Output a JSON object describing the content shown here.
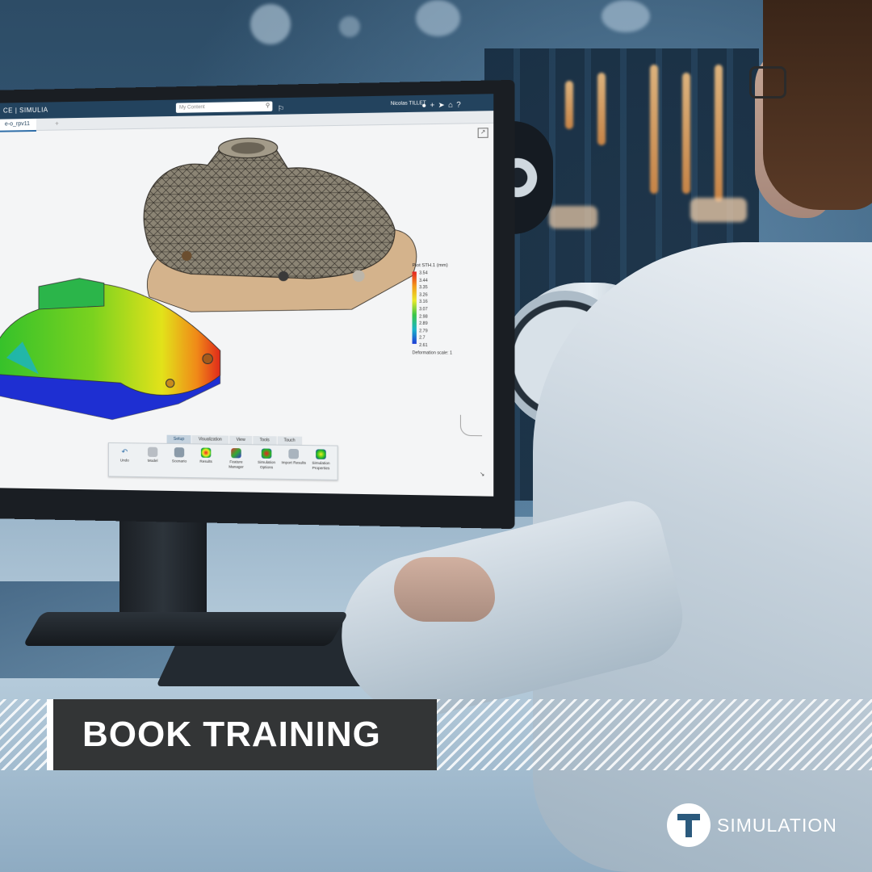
{
  "app": {
    "brand": "CE | SIMULIA",
    "search_placeholder": "My Content",
    "user_name": "Nicolas TILLET",
    "tab_label": "e-o_rpv11",
    "tab_add": "+"
  },
  "legend": {
    "title": "Plot STH.1 (mm)",
    "values": [
      "3.54",
      "3.44",
      "3.35",
      "3.26",
      "3.16",
      "3.07",
      "2.98",
      "2.89",
      "2.79",
      "2.7",
      "2.61"
    ],
    "deformation_scale": "Deformation scale: 1"
  },
  "ribbon": {
    "tabs": [
      "Setup",
      "Visualization",
      "View",
      "Tools",
      "Touch"
    ],
    "active_tab": "Setup",
    "tools": [
      {
        "label": "Undo",
        "icon": "undo-icon"
      },
      {
        "label": "Model",
        "icon": "model-icon"
      },
      {
        "label": "Scenario",
        "icon": "scenario-icon"
      },
      {
        "label": "Results",
        "icon": "results-icon"
      },
      {
        "label": "Feature Manager",
        "icon": "feature-manager-icon"
      },
      {
        "label": "Simulation Options",
        "icon": "simulation-options-icon"
      },
      {
        "label": "Import Results",
        "icon": "import-results-icon"
      },
      {
        "label": "Simulation Properties",
        "icon": "simulation-properties-icon"
      }
    ]
  },
  "banner": {
    "cta": "BOOK TRAINING"
  },
  "logo": {
    "letter": "T",
    "text": "SIMULATION"
  },
  "colors": {
    "banner_bg": "#333536",
    "app_bar": "#23435e",
    "mesh_gray": "#8b8474"
  }
}
